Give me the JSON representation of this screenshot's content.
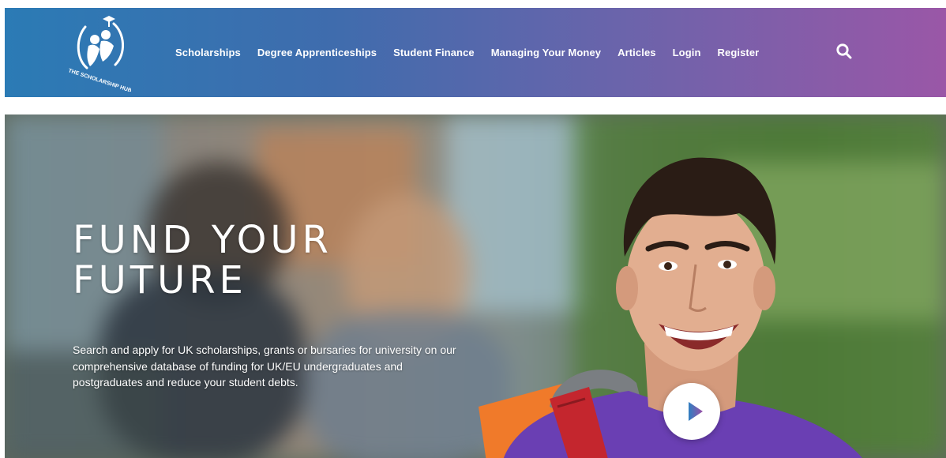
{
  "header": {
    "logo_name": "scholarship-hub-logo",
    "logo_text": "THE SCHOLARSHIP HUB",
    "nav": [
      {
        "label": "Scholarships"
      },
      {
        "label": "Degree Apprenticeships"
      },
      {
        "label": "Student Finance"
      },
      {
        "label": "Managing Your Money"
      },
      {
        "label": "Articles"
      },
      {
        "label": "Login"
      },
      {
        "label": "Register"
      }
    ],
    "search_icon": "search-icon",
    "colors": {
      "gradient_start": "#2b7bb5",
      "gradient_end": "#9a57a7"
    }
  },
  "hero": {
    "title_line1": "FUND YOUR",
    "title_line2": "FUTURE",
    "description": "Search and apply for UK scholarships, grants or bursaries for university on our comprehensive database of funding for UK/EU undergraduates and postgraduates and reduce your student debts.",
    "play_icon": "play-icon",
    "play_colors": {
      "from": "#2f7fc1",
      "to": "#9b4fa6"
    }
  }
}
